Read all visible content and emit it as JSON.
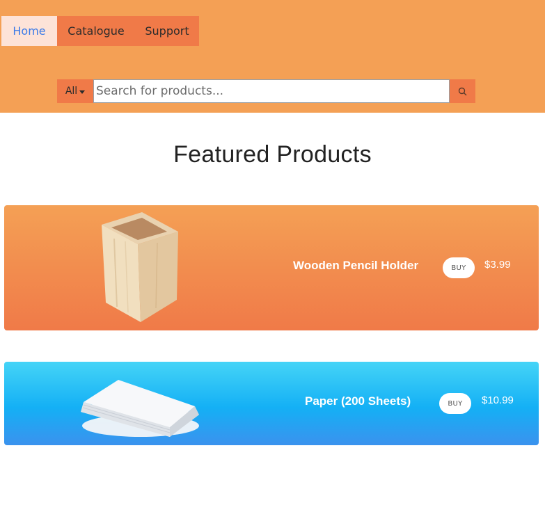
{
  "nav": {
    "items": [
      {
        "label": "Home",
        "active": true
      },
      {
        "label": "Catalogue"
      },
      {
        "label": "Support"
      }
    ]
  },
  "search": {
    "category": "All",
    "placeholder": "Search for products..."
  },
  "page_title": "Featured Products",
  "products": [
    {
      "name": "Wooden Pencil Holder",
      "buy_label": "BUY",
      "price": "$3.99",
      "image_icon": "pencil-holder-icon"
    },
    {
      "name": "Paper (200 Sheets)",
      "buy_label": "BUY",
      "price": "$10.99",
      "image_icon": "paper-stack-icon"
    }
  ],
  "colors": {
    "header": "#f4a055",
    "accent": "#f07a48",
    "active_nav_bg": "#fde3d8",
    "active_nav_text": "#3b7be8",
    "card_blue": "#14b0f5"
  }
}
